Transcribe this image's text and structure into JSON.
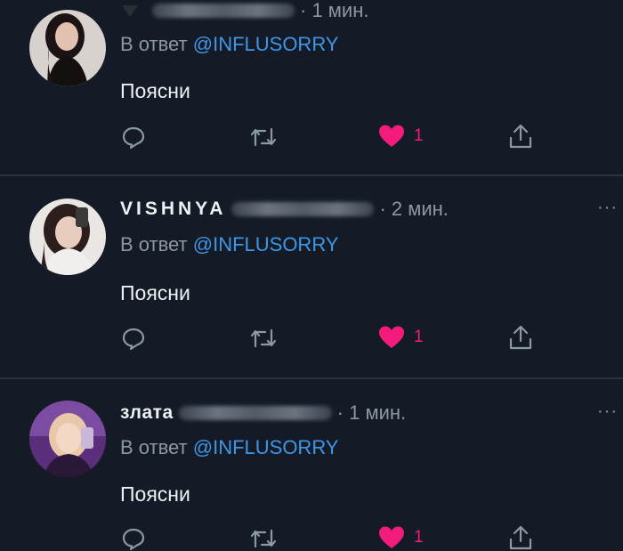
{
  "tweets": [
    {
      "name": "",
      "time": "· 1 мин.",
      "reply_prefix": "В ответ ",
      "reply_handle": "@INFLUSORRY",
      "text": "Поясни",
      "likes": "1"
    },
    {
      "name": "VISHNYA",
      "time": "· 2 мин.",
      "reply_prefix": "В ответ ",
      "reply_handle": "@INFLUSORRY",
      "text": "Поясни",
      "likes": "1",
      "more": "···"
    },
    {
      "name": "злата",
      "time": "· 1 мин.",
      "reply_prefix": "В ответ ",
      "reply_handle": "@INFLUSORRY",
      "text": "Поясни",
      "likes": "1",
      "more": "···"
    }
  ],
  "icons": {
    "reply": "reply-icon",
    "retweet": "retweet-icon",
    "like": "heart-icon",
    "share": "share-icon",
    "more": "more-icon"
  },
  "colors": {
    "background": "#141b26",
    "mention": "#3f96e6",
    "like": "#f31c7c",
    "secondary_text": "#8b98a5",
    "divider": "#2a323d"
  }
}
